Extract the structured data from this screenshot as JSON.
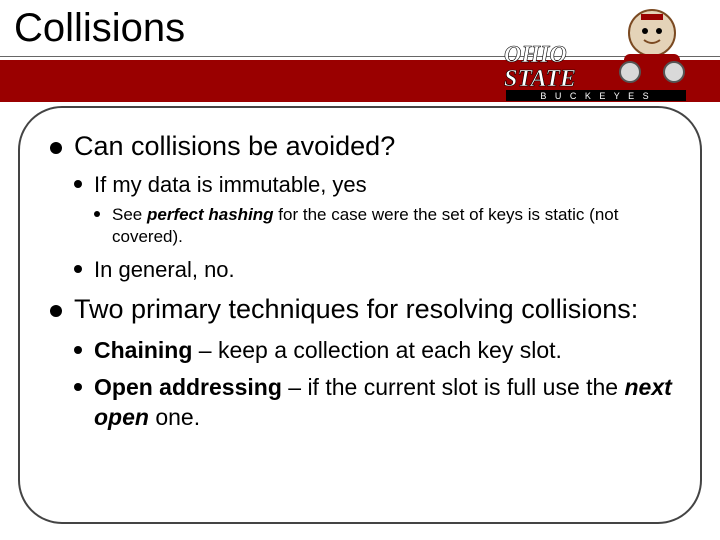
{
  "title": "Collisions",
  "branding": {
    "name": "Ohio State Buckeyes"
  },
  "colors": {
    "accent": "#9a0000"
  },
  "content": {
    "p1": {
      "text": "Can collisions be avoided?",
      "sub": {
        "a": {
          "text": "If my data is immutable, yes",
          "sub": {
            "a_pre": "See ",
            "a_em": "perfect hashing",
            "a_post": " for the case were the set of keys is static (not covered)."
          }
        },
        "b": {
          "text": "In general, no."
        }
      }
    },
    "p2": {
      "text": "Two primary techniques for resolving collisions:",
      "sub": {
        "a": {
          "term": "Chaining",
          "rest": " – keep a collection at each key slot."
        },
        "b": {
          "term": "Open addressing",
          "mid": " – if the current slot is full use the ",
          "em": "next open",
          "post": " one."
        }
      }
    }
  }
}
